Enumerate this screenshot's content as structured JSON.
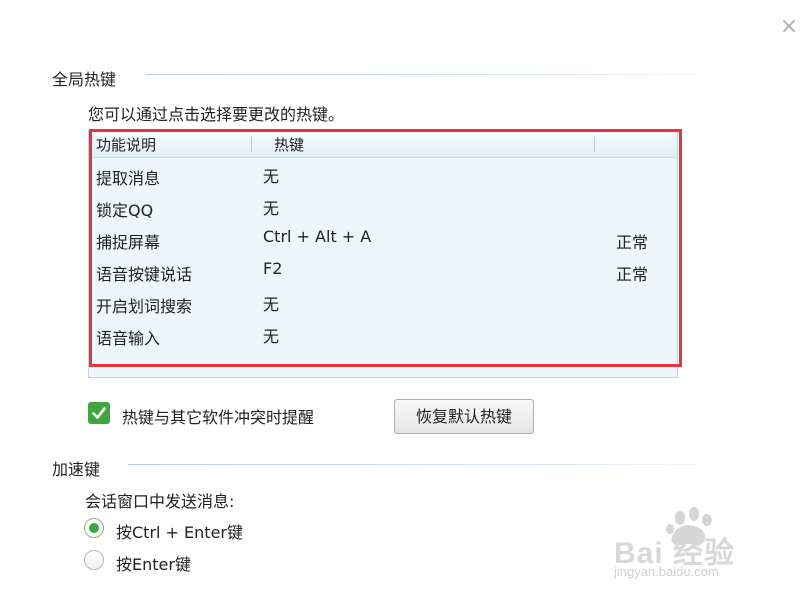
{
  "close_symbol": "×",
  "global_hotkeys": {
    "heading": "全局热键",
    "description": "您可以通过点击选择要更改的热键。",
    "columns": [
      "功能说明",
      "热键"
    ],
    "rows": [
      {
        "function": "提取消息",
        "hotkey": "无",
        "status": ""
      },
      {
        "function": "锁定QQ",
        "hotkey": "无",
        "status": ""
      },
      {
        "function": "捕捉屏幕",
        "hotkey": "Ctrl + Alt + A",
        "status": "正常"
      },
      {
        "function": "语音按键说话",
        "hotkey": "F2",
        "status": "正常"
      },
      {
        "function": "开启划词搜索",
        "hotkey": "无",
        "status": ""
      },
      {
        "function": "语音输入",
        "hotkey": "无",
        "status": ""
      }
    ],
    "conflict_checkbox": {
      "label": "热键与其它软件冲突时提醒",
      "checked": true
    },
    "restore_button": "恢复默认热键"
  },
  "accelerator": {
    "heading": "加速键",
    "description": "会话窗口中发送消息:",
    "options": [
      {
        "label": "按Ctrl + Enter键",
        "selected": true
      },
      {
        "label": "按Enter键",
        "selected": false
      }
    ]
  },
  "watermark": {
    "brand": "Bai 经验",
    "url": "jingyan.baidu.com"
  },
  "colors": {
    "accent_green": "#3ea63e",
    "highlight_red": "#e8323c",
    "table_bg": "#edf6fa"
  }
}
